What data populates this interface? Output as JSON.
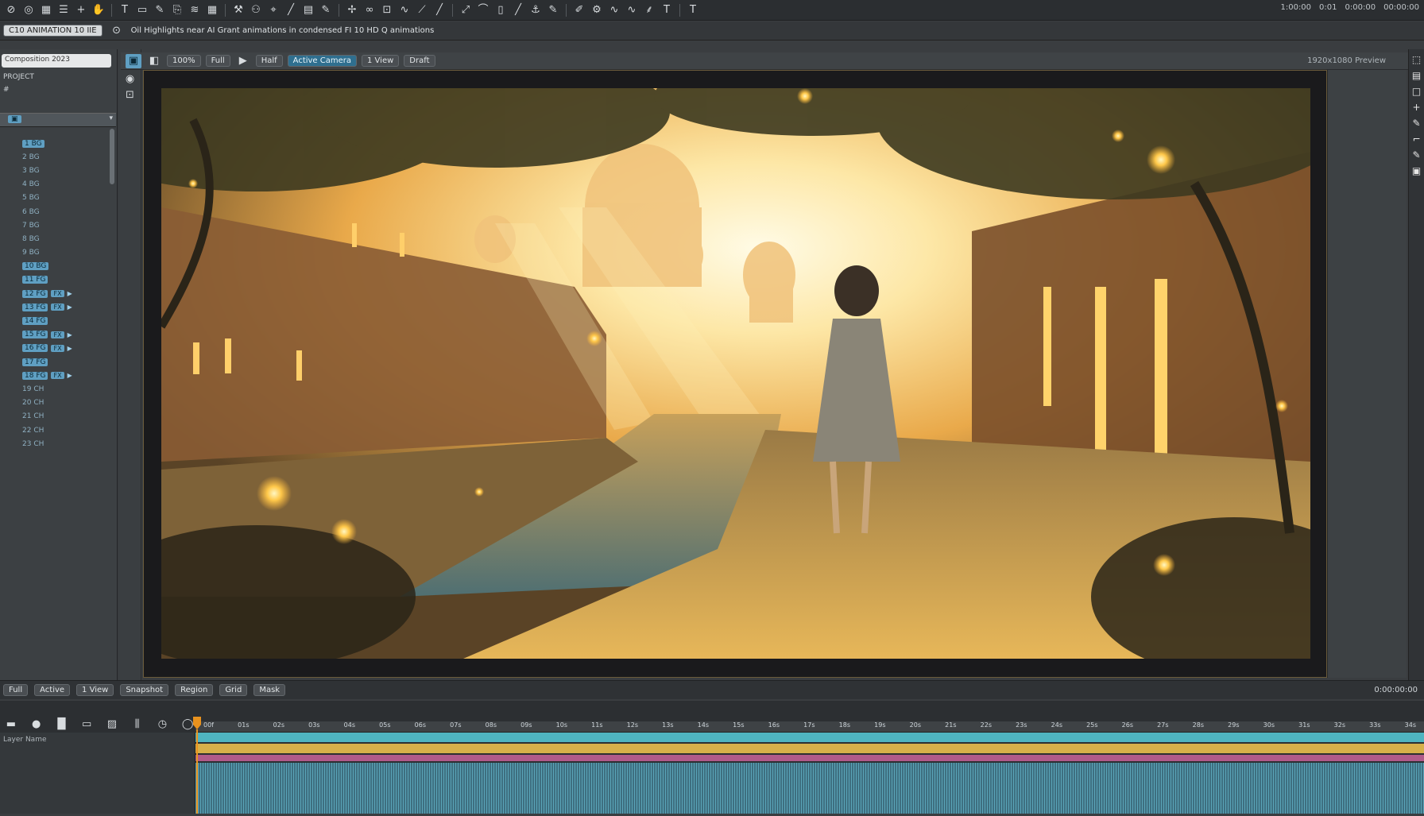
{
  "menubar": {
    "icons": [
      "select-icon",
      "target-icon",
      "grid-icon",
      "align-icon",
      "add-icon",
      "hand-icon",
      "text-icon",
      "shape-icon",
      "pen-icon",
      "stamp-icon",
      "brush-icon",
      "grid-icon",
      "tools-icon",
      "node-icon",
      "pin-icon",
      "line-icon",
      "doc-icon",
      "pen-icon",
      "puppet-icon",
      "link-icon",
      "lock-icon",
      "wave-icon",
      "vector-icon",
      "line-icon",
      "track-icon",
      "curve-icon",
      "page-icon",
      "line-icon",
      "anchor-icon",
      "pen-icon",
      "edit-icon",
      "tool-icon",
      "wave-icon",
      "wave-icon",
      "feather-icon",
      "text-icon",
      "text-icon"
    ],
    "right_readout": [
      "1:00:00",
      "0:01",
      "0:00:00",
      "00:00:00"
    ]
  },
  "statusbar": {
    "project_chip": "C10 ANIMATION 10 IIE",
    "message": "Oil Highlights near AI Grant animations in condensed FI 10 HD Q animations"
  },
  "left_panel": {
    "search": "Composition 2023",
    "header": "PROJECT",
    "sub": "#",
    "layers": [
      {
        "name": "1 BG",
        "selected": true
      },
      {
        "name": "2 BG"
      },
      {
        "name": "3 BG"
      },
      {
        "name": "4 BG"
      },
      {
        "name": "5 BG"
      },
      {
        "name": "6 BG"
      },
      {
        "name": "7 BG"
      },
      {
        "name": "8 BG"
      },
      {
        "name": "9 BG"
      },
      {
        "name": "10 BG",
        "tag": ""
      },
      {
        "name": "11 FG",
        "tag": ""
      },
      {
        "name": "12 FG",
        "tag": "FX",
        "arrow": true
      },
      {
        "name": "13 FG",
        "tag": "FX",
        "arrow": true
      },
      {
        "name": "14 FG"
      },
      {
        "name": "15 FG",
        "tag": "FX",
        "arrow": true
      },
      {
        "name": "16 FG",
        "tag": "FX",
        "arrow": true
      },
      {
        "name": "17 FG"
      },
      {
        "name": "18 FG",
        "tag": "FX",
        "arrow": true
      },
      {
        "name": "19 CH"
      },
      {
        "name": "20 CH"
      },
      {
        "name": "21 CH"
      },
      {
        "name": "22 CH"
      },
      {
        "name": "23 CH"
      }
    ]
  },
  "viewer_toolbar": {
    "items": [
      "100%",
      "Full",
      "Half",
      "Active Camera",
      "1 View",
      "Draft"
    ],
    "right_label": "1920x1080 Preview"
  },
  "scene": {
    "colors": {
      "sun": "#fff6c8",
      "sky": "#f7d07a",
      "glow": "#ffb83a",
      "shadow": "#2a2418",
      "foliage": "#3b3a22"
    }
  },
  "viewer_bottom": {
    "items": [
      "Full",
      "Active",
      "1 View",
      "Snapshot",
      "Region",
      "Grid",
      "Mask"
    ],
    "right": "0:00:00:00"
  },
  "timeline": {
    "tools": [
      "rect-icon",
      "ellipse-icon",
      "solid-icon",
      "shape-icon",
      "pattern-icon",
      "bars-icon",
      "clock-icon",
      "circle-icon"
    ],
    "layer_label": "Layer Name",
    "ticks": [
      "00f",
      "01s",
      "02s",
      "03s",
      "04s",
      "05s",
      "06s",
      "07s",
      "08s",
      "09s",
      "10s",
      "11s",
      "12s",
      "13s",
      "14s",
      "15s",
      "16s",
      "17s",
      "18s",
      "19s",
      "20s",
      "21s",
      "22s",
      "23s",
      "24s",
      "25s",
      "26s",
      "27s",
      "28s",
      "29s",
      "30s",
      "31s",
      "32s",
      "33s",
      "34s"
    ]
  }
}
